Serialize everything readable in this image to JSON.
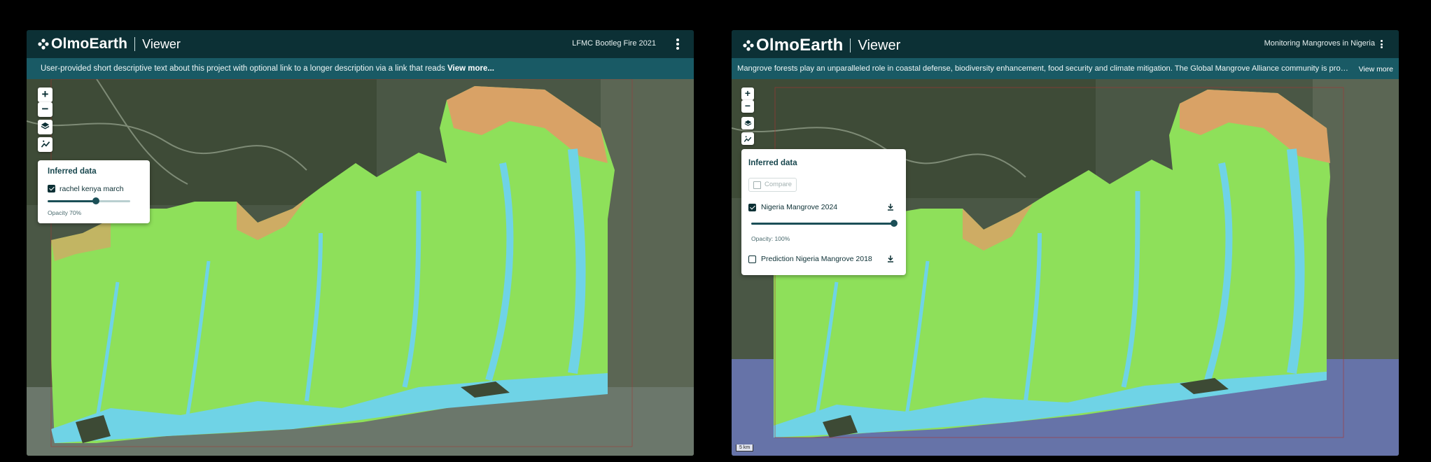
{
  "brand": {
    "name": "OlmoEarth",
    "product": "Viewer"
  },
  "left": {
    "project_title": "LFMC Bootleg Fire 2021",
    "description": "User-provided short descriptive text about this project with optional link to a longer description via a link that reads ",
    "view_more": "View more...",
    "controls": {
      "zoom_in": "+",
      "zoom_out": "−"
    },
    "layers_panel": {
      "title": "Inferred data",
      "layer": {
        "name": "rachel kenya march",
        "checked": true,
        "opacity_label": "Opacity 70%",
        "opacity": 0.7
      }
    }
  },
  "right": {
    "project_title": "Monitoring Mangroves in Nigeria",
    "description": "Mangrove forests play an unparalleled role in coastal defense, biodiversity enhancement, food security and climate mitigation. The Global Mangrove Alliance community is protecting, restoring and expanding mangroves worldwide.",
    "view_more": "View more",
    "controls": {
      "zoom_in": "+",
      "zoom_out": "−"
    },
    "layers_panel": {
      "title": "Inferred data",
      "compare_label": "Compare",
      "layers": [
        {
          "name": "Nigeria Mangrove 2024",
          "checked": true,
          "opacity_label": "Opacity: 100%",
          "opacity": 1.0
        },
        {
          "name": "Prediction Nigeria Mangrove 2018",
          "checked": false
        }
      ]
    },
    "scale_label": "5 km"
  },
  "colors": {
    "header_bg": "#0c3035",
    "desc_bg": "#195a65",
    "land_green": "#8ee05a",
    "water_blue": "#6fd3e6",
    "urban_orange": "#d9a266"
  }
}
